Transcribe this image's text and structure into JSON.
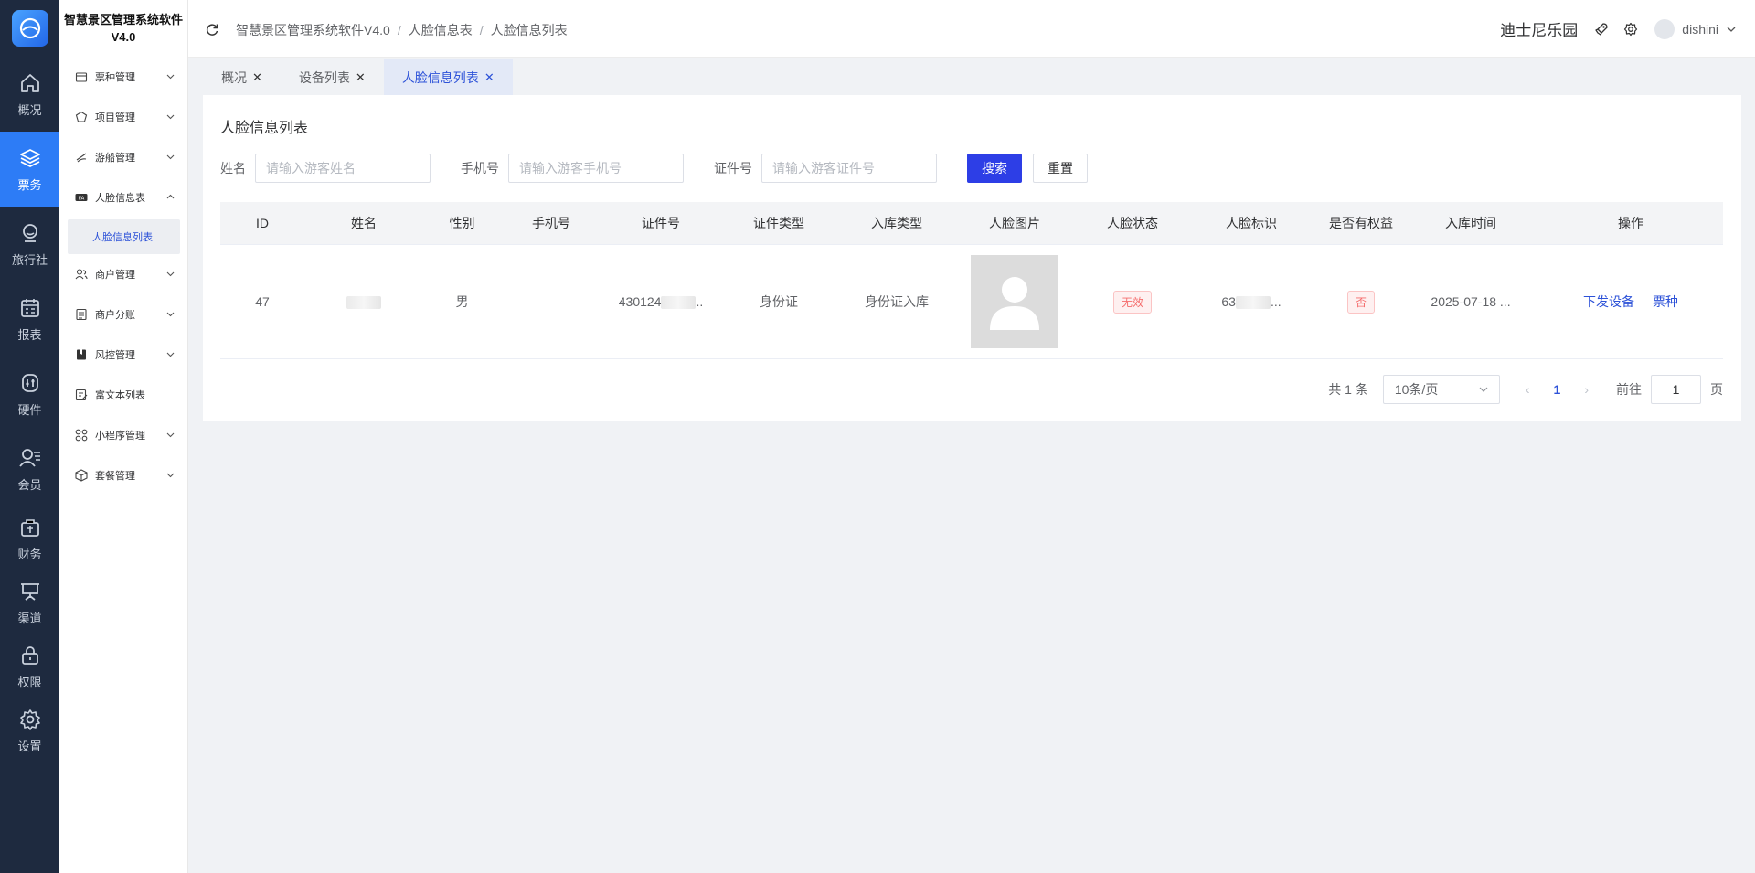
{
  "app": {
    "title_line1": "智慧景区管理系统软件",
    "title_line2": "V4.0"
  },
  "rail": {
    "items": [
      {
        "label": "概况",
        "icon": "home-icon",
        "active": false
      },
      {
        "label": "票务",
        "icon": "layers-icon",
        "active": true
      },
      {
        "label": "旅行社",
        "icon": "user-circle-icon",
        "active": false
      },
      {
        "label": "报表",
        "icon": "calendar-report-icon",
        "active": false
      },
      {
        "label": "硬件",
        "icon": "hardware-icon",
        "active": false
      },
      {
        "label": "会员",
        "icon": "member-icon",
        "active": false
      },
      {
        "label": "财务",
        "icon": "bag-icon",
        "active": false
      },
      {
        "label": "渠道",
        "icon": "channel-icon",
        "active": false
      },
      {
        "label": "权限",
        "icon": "lock-icon",
        "active": false
      },
      {
        "label": "设置",
        "icon": "gear-icon",
        "active": false
      }
    ]
  },
  "sidebar": {
    "items": [
      {
        "label": "票种管理",
        "expanded": false
      },
      {
        "label": "项目管理",
        "expanded": false
      },
      {
        "label": "游船管理",
        "expanded": false
      },
      {
        "label": "人脸信息表",
        "expanded": true
      },
      {
        "label": "商户管理",
        "expanded": false
      },
      {
        "label": "商户分账",
        "expanded": false
      },
      {
        "label": "风控管理",
        "expanded": false
      },
      {
        "label": "富文本列表",
        "expanded": null
      },
      {
        "label": "小程序管理",
        "expanded": false
      },
      {
        "label": "套餐管理",
        "expanded": false
      }
    ],
    "active_child": "人脸信息列表"
  },
  "header": {
    "breadcrumb": [
      "智慧景区管理系统软件V4.0",
      "人脸信息表",
      "人脸信息列表"
    ],
    "park_name": "迪士尼乐园",
    "username": "dishini"
  },
  "tabs": [
    {
      "label": "概况",
      "active": false
    },
    {
      "label": "设备列表",
      "active": false
    },
    {
      "label": "人脸信息列表",
      "active": true
    }
  ],
  "page": {
    "title": "人脸信息列表"
  },
  "filters": {
    "name_label": "姓名",
    "name_placeholder": "请输入游客姓名",
    "phone_label": "手机号",
    "phone_placeholder": "请输入游客手机号",
    "cert_label": "证件号",
    "cert_placeholder": "请输入游客证件号",
    "search_label": "搜索",
    "reset_label": "重置"
  },
  "table": {
    "columns": [
      "ID",
      "姓名",
      "性别",
      "手机号",
      "证件号",
      "证件类型",
      "入库类型",
      "人脸图片",
      "人脸状态",
      "人脸标识",
      "是否有权益",
      "入库时间",
      "操作"
    ],
    "rows": [
      {
        "id": "47",
        "name": "",
        "sex": "男",
        "phone": "",
        "cert_no": "430124",
        "cert_type": "身份证",
        "import_type": "身份证入库",
        "face_status": "无效",
        "face_mark": "63",
        "has_rights": "否",
        "time": "2025-07-18 ...",
        "actions": [
          "下发设备",
          "票种"
        ]
      }
    ]
  },
  "pagination": {
    "total_text": "共 1 条",
    "page_size": "10条/页",
    "current_page": "1",
    "goto_label": "前往",
    "goto_value": "1",
    "page_suffix": "页"
  },
  "colors": {
    "rail_bg": "#1e2a3f",
    "rail_active": "#2d7cf6",
    "primary": "#2d3ee6",
    "link": "#2d52d8",
    "danger": "#f56c6c"
  }
}
